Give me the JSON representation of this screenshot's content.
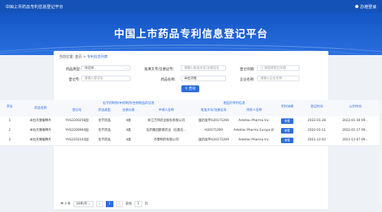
{
  "topbar": {
    "title": "中国上市药品专利信息登记平台",
    "login": "办理登录"
  },
  "banner": {
    "heading": "中国上市药品专利信息登记平台"
  },
  "breadcrumb": {
    "prefix": "当前位置:",
    "home": "首页",
    "sep": ">",
    "current": "专利信息列表"
  },
  "filters": {
    "drug_type": {
      "label": "药品类型:",
      "value": "请选择"
    },
    "approval_no": {
      "label": "批准文号/注册证号:",
      "placeholder": "请输入批准文号/注册证号"
    },
    "reg_date": {
      "label": "登记日期:",
      "placeholder": "请选择登记日期"
    },
    "reg_no": {
      "label": "登记号:",
      "placeholder": "请输入登记号"
    },
    "drug_name": {
      "label": "药品名称:",
      "value": "米拉贝隆"
    },
    "company": {
      "label": "企业名称:",
      "placeholder": "请输入企业名称"
    },
    "search": "查询"
  },
  "table": {
    "seq_header": "序号",
    "name_header": "药品名称",
    "group1": "化学药制剂/中药制剂/生物制品的信息",
    "group2": "相应的专利信息",
    "cols": [
      "登记号",
      "药品类型",
      "注册分类",
      "中请人名称",
      "批准文号/注册证号",
      "持有人名称",
      "专利详细",
      "登记时间",
      "公示时间"
    ],
    "rows": [
      {
        "seq": "1",
        "name": "米拉贝隆缓释片",
        "reg_no": "YHS2200256国",
        "type": "化学药品",
        "cls": "4类",
        "applicant": "浙江万邦药业股份有限公司",
        "approval": "国药准字H20171269",
        "holder": "Astellas Pharma Inc.",
        "detail": "查看",
        "reg_date": "2022-01-28",
        "pub_date": "2022-01-30 09..."
      },
      {
        "seq": "2",
        "name": "米拉贝隆缓释片",
        "reg_no": "YHS2200064国",
        "type": "化学药品",
        "cls": "4类",
        "applicant": "石药集团欧意药业（石家庄...",
        "approval": "H20171269",
        "holder": "Astellas Pharma Europe B.V.",
        "detail": "查看",
        "reg_date": "2022-01-11",
        "pub_date": "2022-01-17 09..."
      },
      {
        "seq": "3",
        "name": "米拉贝隆缓释片",
        "reg_no": "YHS2102143国",
        "type": "化学药品",
        "cls": "4类",
        "applicant": "齐鲁制药有限公司",
        "approval": "国药准字H20171269",
        "holder": "Astellas Pharma Inc.",
        "detail": "查看",
        "reg_date": "2021-12-03",
        "pub_date": "2021-12-07 09..."
      }
    ]
  },
  "pager": {
    "total": "共 3 条",
    "page_size": "10条/页",
    "prev": "‹",
    "page": "1",
    "next": "›",
    "goto": "前往",
    "goto_value": "1",
    "page_unit": "页"
  },
  "colors": {
    "primary": "#2b6de0",
    "topbar": "#1552b8"
  }
}
